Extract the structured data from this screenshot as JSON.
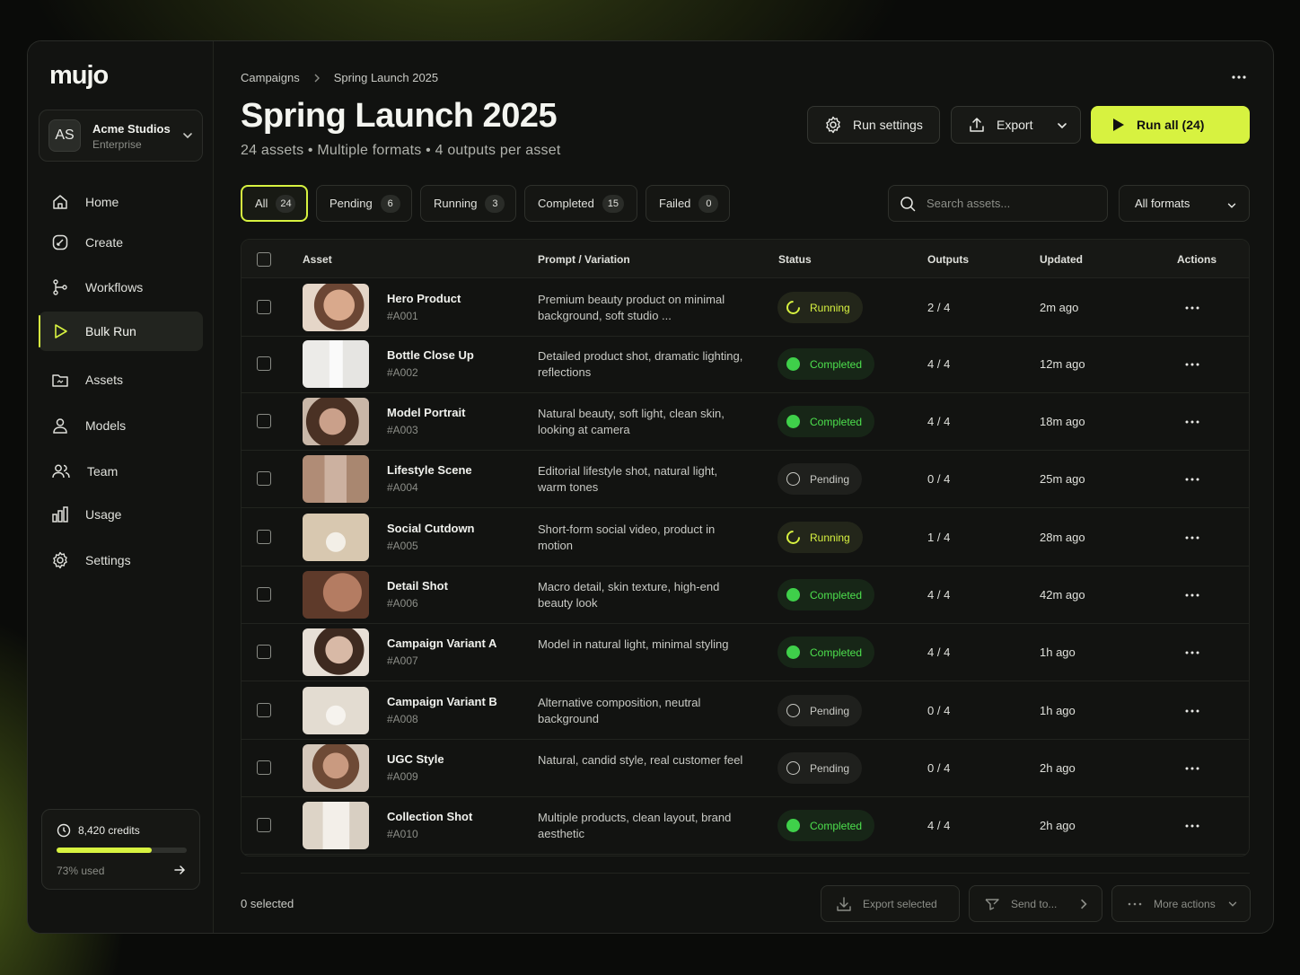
{
  "app": {
    "logo": "mujo"
  },
  "workspace": {
    "initials": "AS",
    "name": "Acme Studios",
    "plan": "Enterprise"
  },
  "nav": [
    {
      "label": "Home",
      "icon": "home-icon"
    },
    {
      "label": "Create",
      "icon": "create-icon"
    },
    {
      "label": "Workflows",
      "icon": "workflows-icon"
    },
    {
      "label": "Bulk Run",
      "icon": "play-icon",
      "active": true
    },
    {
      "label": "Assets",
      "icon": "folder-icon"
    },
    {
      "label": "Models",
      "icon": "user-icon"
    },
    {
      "label": "Team",
      "icon": "team-icon"
    },
    {
      "label": "Usage",
      "icon": "chart-icon"
    },
    {
      "label": "Settings",
      "icon": "gear-icon"
    }
  ],
  "credits": {
    "label": "8,420 credits",
    "used_label": "73% used",
    "used_fraction": 0.73
  },
  "breadcrumb": {
    "parent": "Campaigns",
    "current": "Spring Launch 2025"
  },
  "page": {
    "title": "Spring Launch 2025",
    "subtitle": "24 assets • Multiple formats • 4 outputs per asset"
  },
  "actions": {
    "run_settings": "Run settings",
    "export": "Export",
    "run_all": "Run all (24)"
  },
  "tabs": [
    {
      "label": "All",
      "count": "24",
      "active": true
    },
    {
      "label": "Pending",
      "count": "6"
    },
    {
      "label": "Running",
      "count": "3"
    },
    {
      "label": "Completed",
      "count": "15"
    },
    {
      "label": "Failed",
      "count": "0"
    }
  ],
  "search": {
    "placeholder": "Search assets..."
  },
  "format_filter": {
    "value": "All formats"
  },
  "table": {
    "columns": {
      "asset": "Asset",
      "prompt": "Prompt / Variation",
      "status": "Status",
      "outputs": "Outputs",
      "updated": "Updated",
      "actions": "Actions"
    },
    "rows": [
      {
        "name": "Hero Product",
        "id": "#A001",
        "prompt": "Premium beauty product on minimal background, soft studio ...",
        "status": "Running",
        "outputs": "2 / 4",
        "updated": "2m ago"
      },
      {
        "name": "Bottle Close Up",
        "id": "#A002",
        "prompt": "Detailed product shot, dramatic lighting, reflections",
        "status": "Completed",
        "outputs": "4 / 4",
        "updated": "12m ago"
      },
      {
        "name": "Model Portrait",
        "id": "#A003",
        "prompt": "Natural beauty, soft light, clean skin, looking at camera",
        "status": "Completed",
        "outputs": "4 / 4",
        "updated": "18m ago"
      },
      {
        "name": "Lifestyle Scene",
        "id": "#A004",
        "prompt": "Editorial lifestyle shot, natural light, warm tones",
        "status": "Pending",
        "outputs": "0 / 4",
        "updated": "25m ago"
      },
      {
        "name": "Social Cutdown",
        "id": "#A005",
        "prompt": "Short-form social video, product in motion",
        "status": "Running",
        "outputs": "1 / 4",
        "updated": "28m ago"
      },
      {
        "name": "Detail Shot",
        "id": "#A006",
        "prompt": "Macro detail, skin texture, high-end beauty look",
        "status": "Completed",
        "outputs": "4 / 4",
        "updated": "42m ago"
      },
      {
        "name": "Campaign Variant A",
        "id": "#A007",
        "prompt": "Model in natural light, minimal styling",
        "status": "Completed",
        "outputs": "4 / 4",
        "updated": "1h ago"
      },
      {
        "name": "Campaign Variant B",
        "id": "#A008",
        "prompt": "Alternative composition, neutral background",
        "status": "Pending",
        "outputs": "0 / 4",
        "updated": "1h ago"
      },
      {
        "name": "UGC Style",
        "id": "#A009",
        "prompt": "Natural, candid style, real customer feel",
        "status": "Pending",
        "outputs": "0 / 4",
        "updated": "2h ago"
      },
      {
        "name": "Collection Shot",
        "id": "#A010",
        "prompt": "Multiple products, clean layout, brand aesthetic",
        "status": "Completed",
        "outputs": "4 / 4",
        "updated": "2h ago"
      }
    ]
  },
  "footer": {
    "selected": "0 selected",
    "export_selected": "Export selected",
    "send_to": "Send to...",
    "more_actions": "More actions"
  },
  "colors": {
    "accent": "#d7f240",
    "completed": "#3fd04a",
    "background": "#111210"
  }
}
